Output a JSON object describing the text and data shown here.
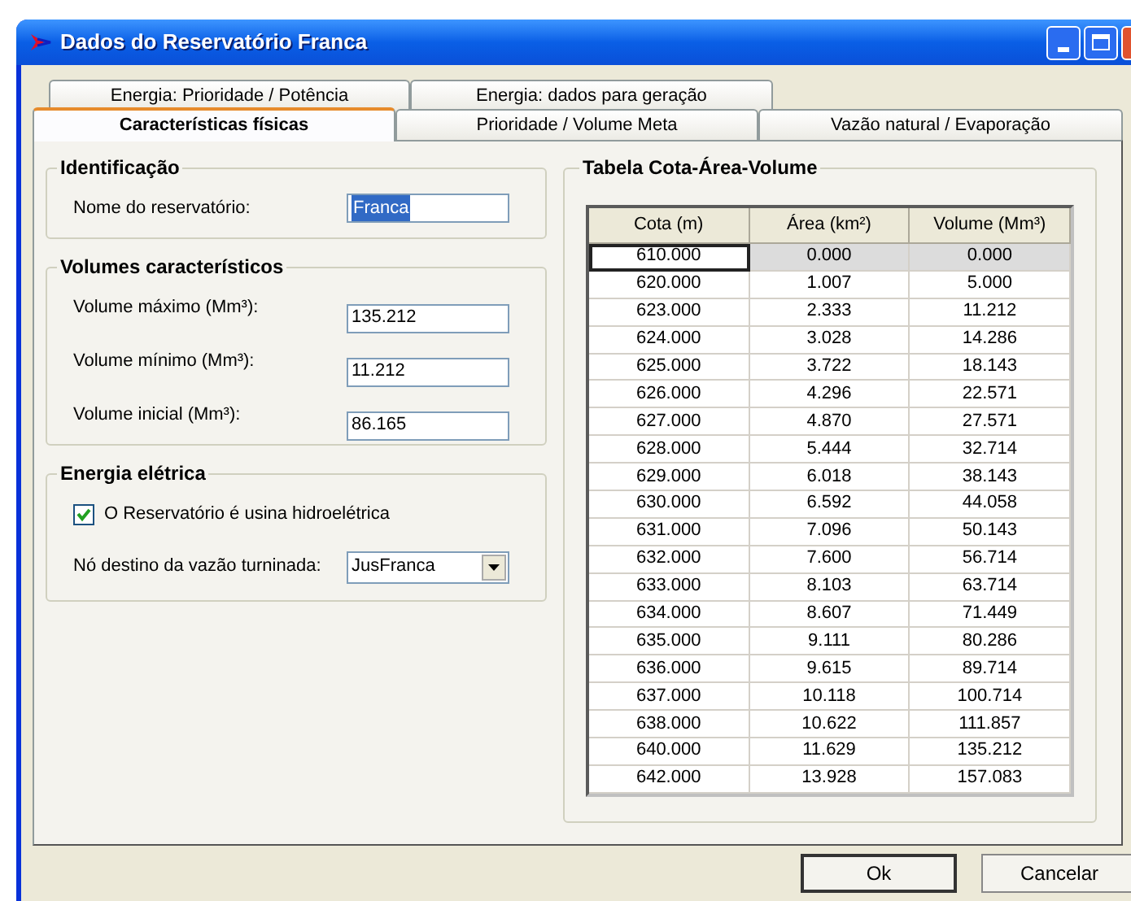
{
  "window": {
    "title": "Dados do Reservatório Franca"
  },
  "tabs": [
    [
      {
        "label": "Energia: Prioridade / Potência",
        "selected": false
      },
      {
        "label": "Energia: dados para geração",
        "selected": false
      }
    ],
    [
      {
        "label": "Características físicas",
        "selected": true
      },
      {
        "label": "Prioridade / Volume Meta",
        "selected": false
      },
      {
        "label": "Vazão natural / Evaporação",
        "selected": false
      }
    ]
  ],
  "identificacao": {
    "title": "Identificação",
    "fields": [
      {
        "label": "Nome do reservatório:",
        "value": "Franca",
        "text_selected": true
      }
    ]
  },
  "volumes": {
    "title": "Volumes característicos",
    "fields": [
      {
        "label": "Volume máximo (Mm³):",
        "value": "135.212",
        "text_selected": false
      },
      {
        "label": "Volume mínimo (Mm³):",
        "value": "11.212",
        "text_selected": false
      },
      {
        "label": "Volume inicial (Mm³):",
        "value": "86.165",
        "text_selected": false
      }
    ]
  },
  "energia": {
    "title": "Energia elétrica",
    "checkbox": {
      "label": "O Reservatório é usina hidroelétrica",
      "checked": true
    },
    "dropdown": {
      "label": "Nó destino da vazão turninada:",
      "value": "JusFranca"
    }
  },
  "table": {
    "title": "Tabela Cota-Área-Volume",
    "columns": [
      "Cota (m)",
      "Área (km²)",
      "Volume (Mm³)"
    ],
    "rows": [
      {
        "cells": [
          "610.000",
          "0.000",
          "0.000"
        ],
        "selected": true
      },
      {
        "cells": [
          "620.000",
          "1.007",
          "5.000"
        ],
        "selected": false
      },
      {
        "cells": [
          "623.000",
          "2.333",
          "11.212"
        ],
        "selected": false
      },
      {
        "cells": [
          "624.000",
          "3.028",
          "14.286"
        ],
        "selected": false
      },
      {
        "cells": [
          "625.000",
          "3.722",
          "18.143"
        ],
        "selected": false
      },
      {
        "cells": [
          "626.000",
          "4.296",
          "22.571"
        ],
        "selected": false
      },
      {
        "cells": [
          "627.000",
          "4.870",
          "27.571"
        ],
        "selected": false
      },
      {
        "cells": [
          "628.000",
          "5.444",
          "32.714"
        ],
        "selected": false
      },
      {
        "cells": [
          "629.000",
          "6.018",
          "38.143"
        ],
        "selected": false
      },
      {
        "cells": [
          "630.000",
          "6.592",
          "44.058"
        ],
        "selected": false
      },
      {
        "cells": [
          "631.000",
          "7.096",
          "50.143"
        ],
        "selected": false
      },
      {
        "cells": [
          "632.000",
          "7.600",
          "56.714"
        ],
        "selected": false
      },
      {
        "cells": [
          "633.000",
          "8.103",
          "63.714"
        ],
        "selected": false
      },
      {
        "cells": [
          "634.000",
          "8.607",
          "71.449"
        ],
        "selected": false
      },
      {
        "cells": [
          "635.000",
          "9.111",
          "80.286"
        ],
        "selected": false
      },
      {
        "cells": [
          "636.000",
          "9.615",
          "89.714"
        ],
        "selected": false
      },
      {
        "cells": [
          "637.000",
          "10.118",
          "100.714"
        ],
        "selected": false
      },
      {
        "cells": [
          "638.000",
          "10.622",
          "111.857"
        ],
        "selected": false
      },
      {
        "cells": [
          "640.000",
          "11.629",
          "135.212"
        ],
        "selected": false
      },
      {
        "cells": [
          "642.000",
          "13.928",
          "157.083"
        ],
        "selected": false
      }
    ]
  },
  "buttons": [
    "Ok",
    "Cancelar"
  ]
}
